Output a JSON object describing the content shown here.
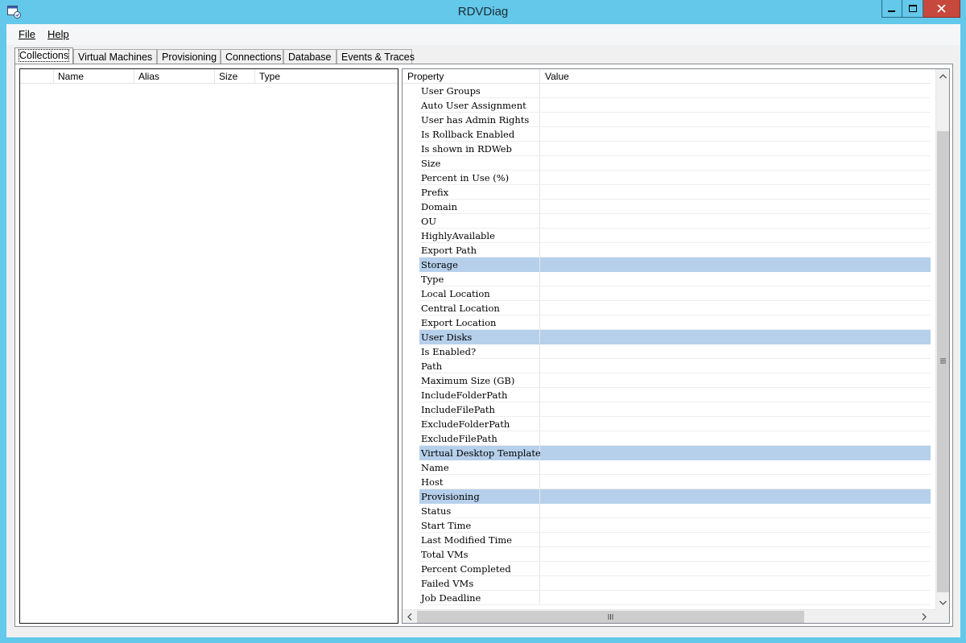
{
  "window": {
    "title": "RDVDiag",
    "icon": "app-window-icon"
  },
  "menu": {
    "file": "File",
    "help": "Help"
  },
  "tabs": [
    {
      "label": "Collections",
      "active": true
    },
    {
      "label": "Virtual Machines",
      "active": false
    },
    {
      "label": "Provisioning",
      "active": false
    },
    {
      "label": "Connections",
      "active": false
    },
    {
      "label": "Database",
      "active": false
    },
    {
      "label": "Events & Traces",
      "active": false
    }
  ],
  "collections_list": {
    "columns": [
      "",
      "Name",
      "Alias",
      "Size",
      "Type"
    ]
  },
  "property_grid": {
    "columns": [
      "Property",
      "Value"
    ],
    "rows": [
      {
        "name": "User Groups",
        "value": "",
        "group": false
      },
      {
        "name": "Auto User Assignment",
        "value": "",
        "group": false
      },
      {
        "name": "User has Admin Rights",
        "value": "",
        "group": false
      },
      {
        "name": "Is Rollback Enabled",
        "value": "",
        "group": false
      },
      {
        "name": "Is shown in RDWeb",
        "value": "",
        "group": false
      },
      {
        "name": "Size",
        "value": "",
        "group": false
      },
      {
        "name": "Percent in Use (%)",
        "value": "",
        "group": false
      },
      {
        "name": "Prefix",
        "value": "",
        "group": false
      },
      {
        "name": "Domain",
        "value": "",
        "group": false
      },
      {
        "name": "OU",
        "value": "",
        "group": false
      },
      {
        "name": "HighlyAvailable",
        "value": "",
        "group": false
      },
      {
        "name": "Export Path",
        "value": "",
        "group": false
      },
      {
        "name": "Storage",
        "value": "",
        "group": true
      },
      {
        "name": "Type",
        "value": "",
        "group": false
      },
      {
        "name": "Local Location",
        "value": "",
        "group": false
      },
      {
        "name": "Central Location",
        "value": "",
        "group": false
      },
      {
        "name": "Export Location",
        "value": "",
        "group": false
      },
      {
        "name": "User Disks",
        "value": "",
        "group": true
      },
      {
        "name": "Is Enabled?",
        "value": "",
        "group": false
      },
      {
        "name": "Path",
        "value": "",
        "group": false
      },
      {
        "name": "Maximum Size (GB)",
        "value": "",
        "group": false
      },
      {
        "name": "IncludeFolderPath",
        "value": "",
        "group": false
      },
      {
        "name": "IncludeFilePath",
        "value": "",
        "group": false
      },
      {
        "name": "ExcludeFolderPath",
        "value": "",
        "group": false
      },
      {
        "name": "ExcludeFilePath",
        "value": "",
        "group": false
      },
      {
        "name": "Virtual Desktop Template",
        "value": "",
        "group": true
      },
      {
        "name": "Name",
        "value": "",
        "group": false
      },
      {
        "name": "Host",
        "value": "",
        "group": false
      },
      {
        "name": "Provisioning",
        "value": "",
        "group": true
      },
      {
        "name": "Status",
        "value": "",
        "group": false
      },
      {
        "name": "Start Time",
        "value": "",
        "group": false
      },
      {
        "name": "Last Modified Time",
        "value": "",
        "group": false
      },
      {
        "name": "Total VMs",
        "value": "",
        "group": false
      },
      {
        "name": "Percent Completed",
        "value": "",
        "group": false
      },
      {
        "name": "Failed VMs",
        "value": "",
        "group": false
      },
      {
        "name": "Job Deadline",
        "value": "",
        "group": false
      }
    ]
  },
  "colors": {
    "titlebar": "#63c8ea",
    "close_button": "#c7483c",
    "group_row": "#b6d0eb"
  }
}
